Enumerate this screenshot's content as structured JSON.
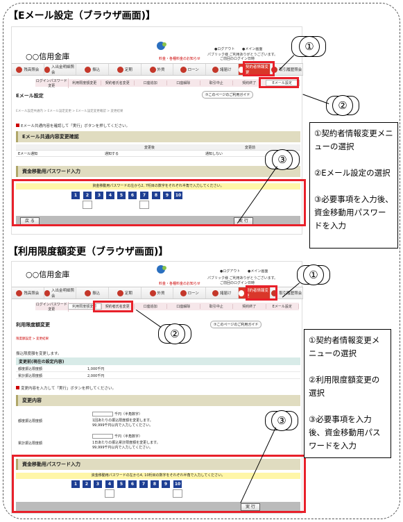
{
  "headings": {
    "top": "【Eメール設定（ブラウザ画面)】",
    "bottom": "【利用限度額変更（ブラウザ画面)】"
  },
  "bank_name": "○○信用金庫",
  "top_links": {
    "logout": "●ログアウト",
    "main": "●メイン画面",
    "greeting": "パブリック様 ご利用ありがとうございます。",
    "last_login": "ご前回のログイン日時",
    "fee_link": "料金・各種料金のお知らせ"
  },
  "menu": [
    {
      "label": "残高照会"
    },
    {
      "label": "入出金明細照会"
    },
    {
      "label": "振込"
    },
    {
      "label": "定期"
    },
    {
      "label": "外貨"
    },
    {
      "label": "ローン"
    },
    {
      "label": "諸届け"
    },
    {
      "label": "契約者情報変更"
    },
    {
      "label": "取引履歴照会"
    }
  ],
  "submenu": [
    "ログインパスワード変更",
    "利用限度額変更",
    "契約者氏名変更",
    "口座追加",
    "口座解除",
    "取引中止",
    "契約終了",
    "Eメール設定"
  ],
  "screen1": {
    "title": "Eメール設定",
    "help": "⑦このページのご利用ガイド",
    "crumb": "Eメール設定共通内 > Eメール設定変更 > Eメール設定変更確認 > 変更結果",
    "notice": "Eメール共通内容を確認して「実行」ボタンを押してください。",
    "section": "Eメール共通内容変更確認",
    "col_after": "変更後",
    "col_before": "変更前",
    "row_label": "Eメール通知",
    "row_after": "通知する",
    "row_before": "通知しない",
    "pw_section": "資金移動用パスワード入力",
    "pw_caption": "資金移動用パスワードの左から2, 7桁目の数字をそれぞれ半角で入力してください。",
    "back": "戻 る",
    "exec": "実 行"
  },
  "screen2": {
    "title": "利用限度額変更",
    "help": "⑦このページのご利用ガイド",
    "crumb": "限度額設定 > 変更結果",
    "intro": "振込限度額を変更します。",
    "current_head": "変更前(現在の設定内容)",
    "current_rows": [
      {
        "label": "都度振込限度額",
        "value": "1,000千円"
      },
      {
        "label": "累計振込限度額",
        "value": "2,000千円"
      }
    ],
    "notice": "変更内容を入力して「実行」ボタンを押してください。",
    "section": "変更内容",
    "change_rows": [
      {
        "label": "都度振込限度額",
        "unit": "千円（半角数字）",
        "line2": "1回あたりの振込限度額を変更します。",
        "line3": "99,999千円以内で入力してください。"
      },
      {
        "label": "累計振込限度額",
        "unit": "千円（半角数字）",
        "line2": "1日あたりの振込累計限度額を変更します。",
        "line3": "99,999千円以内で入力してください。"
      }
    ],
    "pw_section": "資金移動用パスワード入力",
    "pw_caption": "資金移動用パスワードの左から4, 10桁目の数字をそれぞれ半角で入力してください。",
    "exec": "実 行"
  },
  "digits": [
    "1",
    "2",
    "3",
    "4",
    "5",
    "6",
    "7",
    "8",
    "9",
    "10"
  ],
  "callouts": [
    "①",
    "②",
    "③"
  ],
  "note1": "①契約者情報変更メニューの選択\n\n②Eメール設定の選択\n\n③必要事項を入力後、資金移動用パスワードを入力",
  "note2": "①契約者情報変更メニューの選択\n\n②利用限度額変更の選択\n\n③必要事項を入力後、資金移動用パスワードを入力"
}
